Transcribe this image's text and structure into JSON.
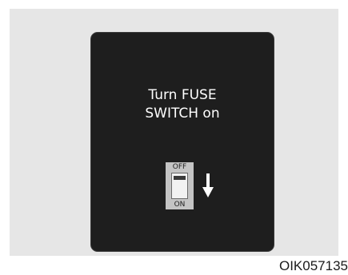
{
  "screen": {
    "message_line1": "Turn FUSE",
    "message_line2": "SWITCH on"
  },
  "fuse_switch": {
    "off_label": "OFF",
    "on_label": "ON",
    "action_icon": "arrow-down-icon"
  },
  "figure": {
    "code": "OIK057135"
  },
  "colors": {
    "background_panel": "#e6e6e6",
    "screen": "#1e1e1e",
    "text": "#ffffff",
    "switch_body": "#c4c4c4"
  }
}
